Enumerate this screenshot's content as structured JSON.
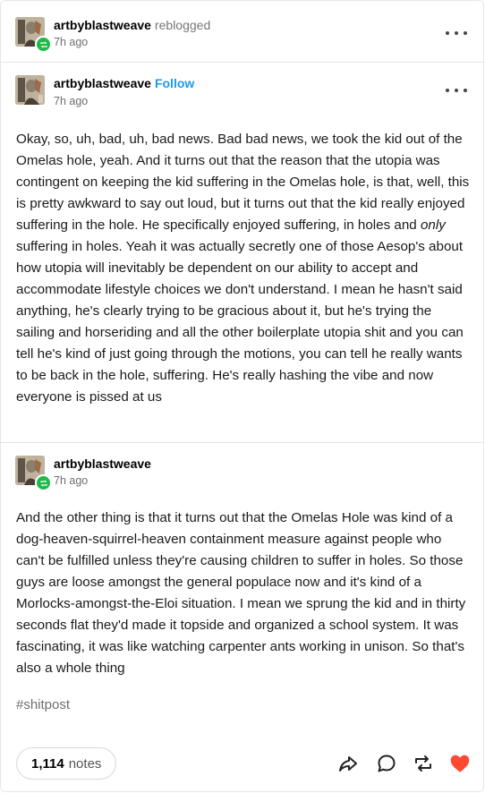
{
  "reblog_header": {
    "username": "artbyblastweave",
    "action": "reblogged",
    "time": "7h ago"
  },
  "original_post": {
    "username": "artbyblastweave",
    "follow_label": "Follow",
    "time": "7h ago",
    "text_before_emph": "Okay, so, uh, bad, uh, bad news. Bad bad news, we took the kid out of the Omelas hole, yeah. And it turns out that the reason that the utopia was contingent on keeping the kid suffering in the Omelas hole, is that, well, this is pretty awkward to say out loud, but it turns out that the kid really enjoyed suffering in the hole. He specifically enjoyed suffering, in holes and ",
    "text_emph": "only",
    "text_after_emph": " suffering in holes. Yeah it was actually secretly one of those Aesop's about how utopia will inevitably be dependent on our ability to accept and accommodate lifestyle choices we don't understand. I mean he hasn't said anything, he's clearly trying to be gracious about it, but he's trying the sailing and horseriding and all the other boilerplate utopia shit and you can tell he's kind of just going through the motions, you can tell he really wants to be back in the hole, suffering. He's really hashing the vibe and now everyone is pissed at us"
  },
  "reblog_post": {
    "username": "artbyblastweave",
    "time": "7h ago",
    "text": "And the other thing is that it turns out that the Omelas Hole was kind of a dog-heaven-squirrel-heaven containment measure against people who can't be fulfilled unless they're causing children to suffer in holes. So those guys are loose amongst the general populace now and it's kind of a Morlocks-amongst-the-Eloi situation. I mean we sprung the kid and in thirty seconds flat they'd made it topside and organized a school system. It was fascinating, it was like watching carpenter ants working in unison. So that's also a whole thing"
  },
  "tags": [
    "#shitpost"
  ],
  "footer": {
    "notes_count": "1,114",
    "notes_label": "notes",
    "icons": [
      "share-icon",
      "reply-icon",
      "reblog-icon",
      "like-icon"
    ],
    "like_color": "#ff4930"
  },
  "colors": {
    "follow": "#1a9be8",
    "reblog_badge": "#1fb84a"
  }
}
